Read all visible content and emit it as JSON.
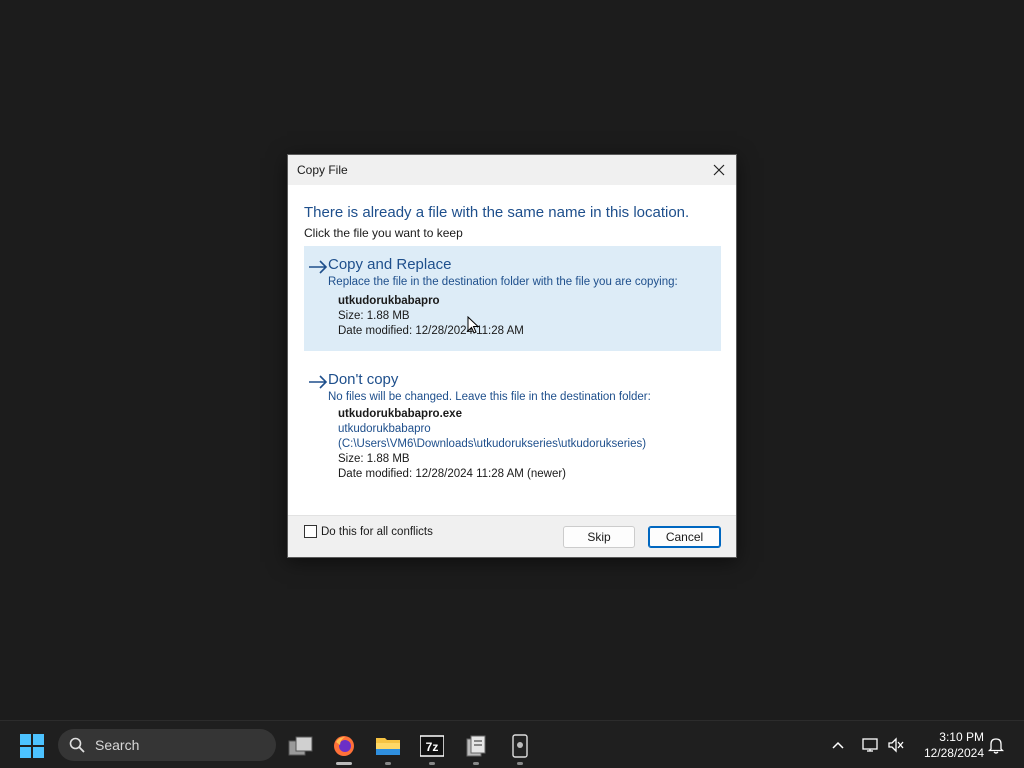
{
  "dialog": {
    "title": "Copy File",
    "heading": "There is already a file with the same name in this location.",
    "subheading": "Click the file you want to keep",
    "replace": {
      "title": "Copy and Replace",
      "description": "Replace the file in the destination folder with the file you are copying:",
      "file_name": "utkudorukbabapro",
      "size": "Size: 1.88 MB",
      "date": "Date modified: 12/28/2024 11:28 AM"
    },
    "dont_copy": {
      "title": "Don't copy",
      "description": "No files will be changed. Leave this file in the destination folder:",
      "file_name": "utkudorukbabapro.exe",
      "folder_name": "utkudorukbabapro",
      "folder_path": "(C:\\Users\\VM6\\Downloads\\utkudorukseries\\utkudorukseries)",
      "size": "Size: 1.88 MB",
      "date": "Date modified: 12/28/2024 11:28 AM (newer)"
    },
    "checkbox_label": "Do this for all conflicts",
    "skip_label": "Skip",
    "cancel_label": "Cancel"
  },
  "taskbar": {
    "search_placeholder": "Search",
    "time": "3:10 PM",
    "date": "12/28/2024",
    "apps": [
      "task-view",
      "firefox",
      "file-explorer",
      "7-zip",
      "clipboard-app",
      "phone-app"
    ]
  },
  "colors": {
    "accent_text": "#1e4f8c",
    "selected_bg": "#ddecf7",
    "desktop": "#1c1c1c"
  }
}
